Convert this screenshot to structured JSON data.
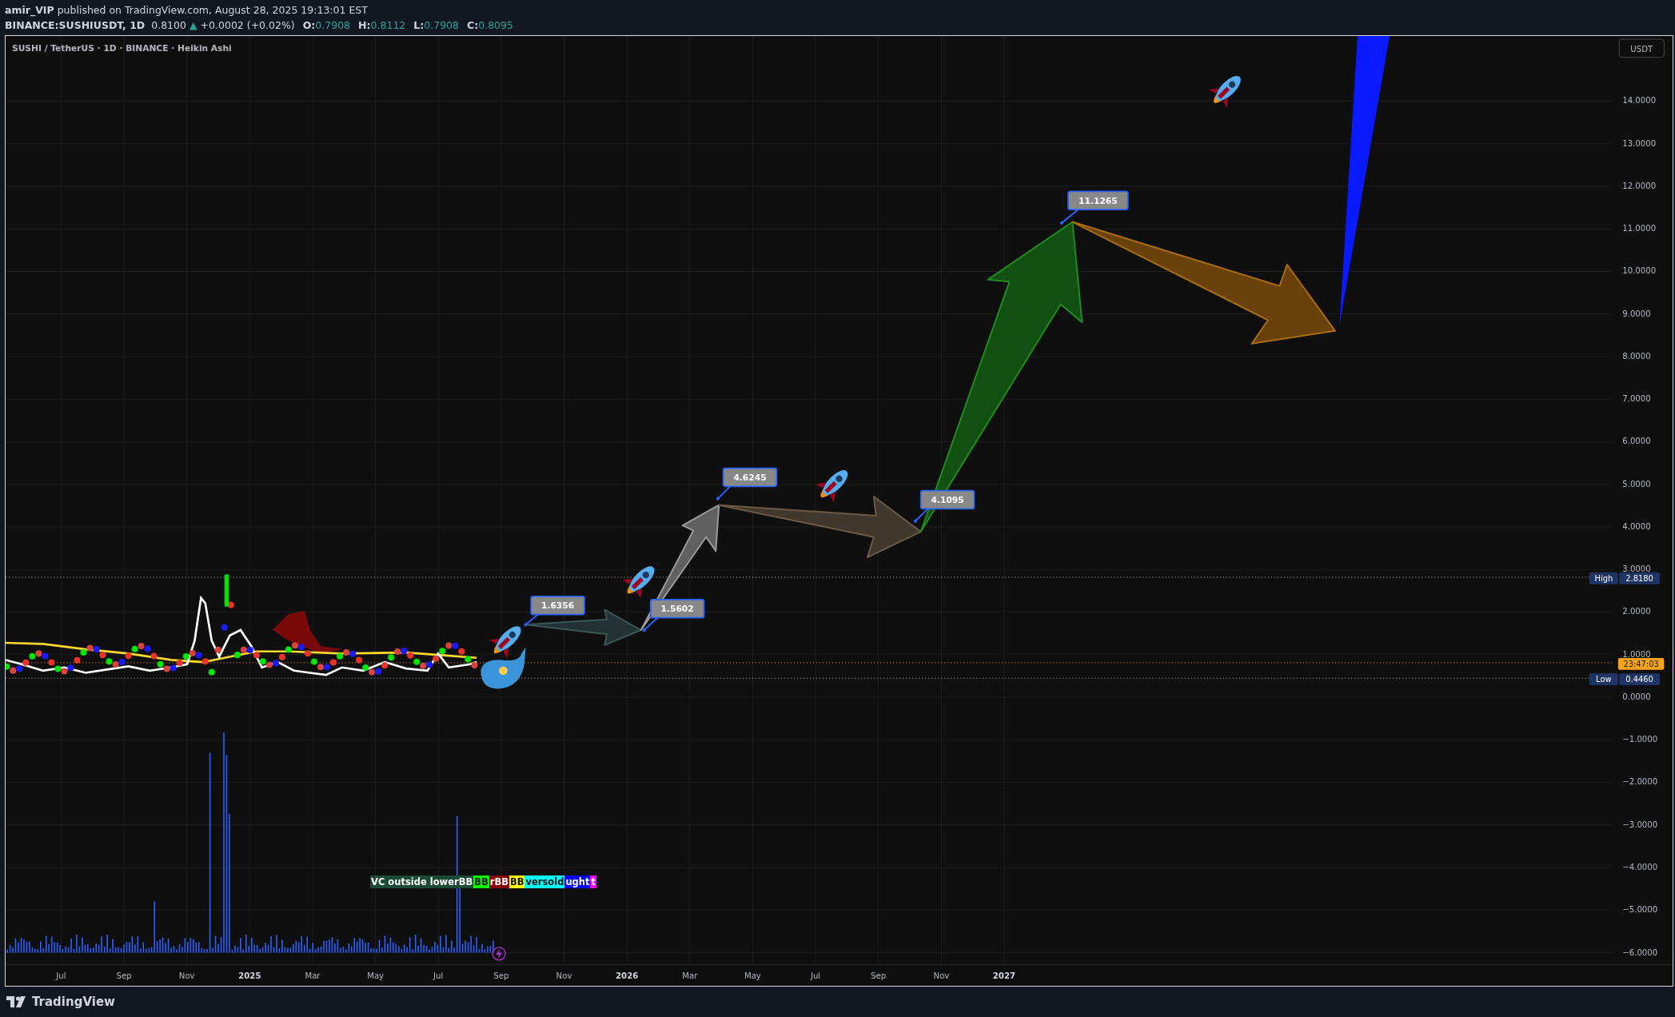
{
  "header": {
    "author": "amir_VIP",
    "published": "published on TradingView.com, August 28, 2025 19:13:01 EST"
  },
  "quote": {
    "symbol": "BINANCE:SUSHIUSDT, 1D",
    "price": "0.8100",
    "arrow": "▲",
    "change": "+0.0002 (+0.02%)",
    "ohlc": [
      {
        "label": "O:",
        "value": "0.7908"
      },
      {
        "label": "H:",
        "value": "0.8112"
      },
      {
        "label": "L:",
        "value": "0.7908"
      },
      {
        "label": "C:",
        "value": "0.8095"
      }
    ]
  },
  "chart": {
    "legend": "SUSHI / TetherUS · 1D · BINANCE · Heikin Ashi",
    "currency_button": "USDT",
    "price_axis": [
      "14.0000",
      "13.0000",
      "12.0000",
      "11.0000",
      "10.0000",
      "9.0000",
      "8.0000",
      "7.0000",
      "6.0000",
      "5.0000",
      "4.0000",
      "3.0000",
      "2.0000",
      "1.0000",
      "0.0000",
      "−1.0000",
      "−2.0000",
      "−3.0000",
      "−4.0000",
      "−5.0000",
      "−6.0000"
    ],
    "price_tags": [
      {
        "kind": "high",
        "label": "High",
        "value": "2.8180"
      },
      {
        "kind": "countdown",
        "value": "23:47:03"
      },
      {
        "kind": "low",
        "label": "Low",
        "value": "0.4460"
      }
    ],
    "time_axis": [
      {
        "label": "Jul",
        "major": false
      },
      {
        "label": "Sep",
        "major": false
      },
      {
        "label": "Nov",
        "major": false
      },
      {
        "label": "2025",
        "major": true
      },
      {
        "label": "Mar",
        "major": false
      },
      {
        "label": "May",
        "major": false
      },
      {
        "label": "Jul",
        "major": false
      },
      {
        "label": "Sep",
        "major": false
      },
      {
        "label": "Nov",
        "major": false
      },
      {
        "label": "2026",
        "major": true
      },
      {
        "label": "Mar",
        "major": false
      },
      {
        "label": "May",
        "major": false
      },
      {
        "label": "Jul",
        "major": false
      },
      {
        "label": "Sep",
        "major": false
      },
      {
        "label": "Nov",
        "major": false
      },
      {
        "label": "2027",
        "major": true
      }
    ],
    "callouts": [
      "1.6356",
      "1.5602",
      "4.6245",
      "4.1095",
      "11.1265"
    ],
    "signal_label": {
      "segments": [
        {
          "text": "VC outside lowerBB",
          "color": "#1a4a33"
        },
        {
          "text": "BB",
          "color": "#00ff00"
        },
        {
          "text": "rBB",
          "color": "#8b0000"
        },
        {
          "text": "BB",
          "color": "#ffff00"
        },
        {
          "text": "versold",
          "color": "#00ffff"
        },
        {
          "text": "ught",
          "color": "#0000ff"
        },
        {
          "text": "t",
          "color": "#ff00ff"
        }
      ]
    }
  },
  "footer": {
    "brand": "TradingView"
  }
}
